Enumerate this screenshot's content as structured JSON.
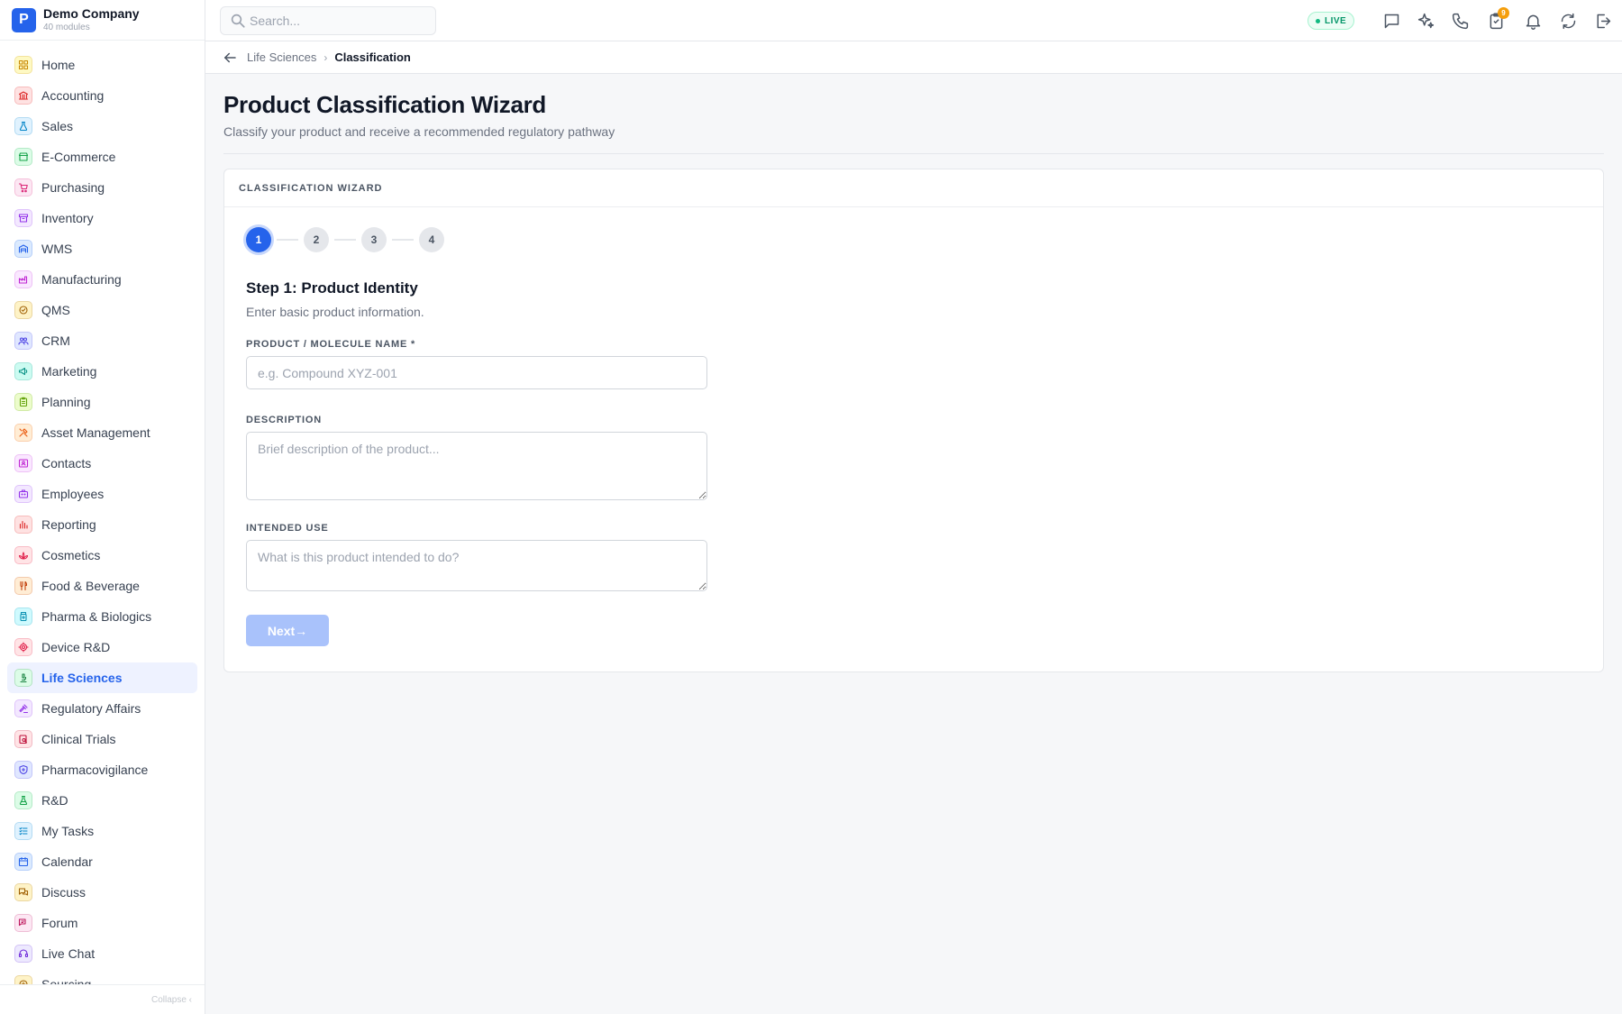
{
  "brand": {
    "logo_letter": "P",
    "name": "Demo Company",
    "subtitle": "40 modules"
  },
  "sidebar": {
    "items": [
      {
        "label": "Home",
        "icon": "grid-icon",
        "color": "#ca8a04",
        "bg": "#fef9c3",
        "active": false
      },
      {
        "label": "Accounting",
        "icon": "bank-icon",
        "color": "#dc2626",
        "bg": "#fee2e2",
        "active": false
      },
      {
        "label": "Sales",
        "icon": "flask-icon",
        "color": "#0284c7",
        "bg": "#e0f2fe",
        "active": false
      },
      {
        "label": "E-Commerce",
        "icon": "store-icon",
        "color": "#16a34a",
        "bg": "#dcfce7",
        "active": false
      },
      {
        "label": "Purchasing",
        "icon": "cart-icon",
        "color": "#db2777",
        "bg": "#fce7f3",
        "active": false
      },
      {
        "label": "Inventory",
        "icon": "archive-icon",
        "color": "#9333ea",
        "bg": "#f3e8ff",
        "active": false
      },
      {
        "label": "WMS",
        "icon": "warehouse-icon",
        "color": "#2563eb",
        "bg": "#dbeafe",
        "active": false
      },
      {
        "label": "Manufacturing",
        "icon": "factory-icon",
        "color": "#c026d3",
        "bg": "#fae8ff",
        "active": false
      },
      {
        "label": "QMS",
        "icon": "check-badge-icon",
        "color": "#a16207",
        "bg": "#fef3c7",
        "active": false
      },
      {
        "label": "CRM",
        "icon": "users-icon",
        "color": "#4f46e5",
        "bg": "#e0e7ff",
        "active": false
      },
      {
        "label": "Marketing",
        "icon": "megaphone-icon",
        "color": "#0d9488",
        "bg": "#ccfbf1",
        "active": false
      },
      {
        "label": "Planning",
        "icon": "clipboard-icon",
        "color": "#65a30d",
        "bg": "#ecfccb",
        "active": false
      },
      {
        "label": "Asset Management",
        "icon": "tools-icon",
        "color": "#ea580c",
        "bg": "#ffedd5",
        "active": false
      },
      {
        "label": "Contacts",
        "icon": "contact-card-icon",
        "color": "#c026d3",
        "bg": "#fae8ff",
        "active": false
      },
      {
        "label": "Employees",
        "icon": "briefcase-icon",
        "color": "#9333ea",
        "bg": "#f3e8ff",
        "active": false
      },
      {
        "label": "Reporting",
        "icon": "bar-chart-icon",
        "color": "#dc2626",
        "bg": "#fee2e2",
        "active": false
      },
      {
        "label": "Cosmetics",
        "icon": "lotus-icon",
        "color": "#e11d48",
        "bg": "#ffe4e6",
        "active": false
      },
      {
        "label": "Food & Beverage",
        "icon": "utensils-icon",
        "color": "#c2410c",
        "bg": "#ffedd5",
        "active": false
      },
      {
        "label": "Pharma & Biologics",
        "icon": "pill-bottle-icon",
        "color": "#0891b2",
        "bg": "#cffafe",
        "active": false
      },
      {
        "label": "Device R&D",
        "icon": "gear-chip-icon",
        "color": "#e11d48",
        "bg": "#ffe4e6",
        "active": false
      },
      {
        "label": "Life Sciences",
        "icon": "microscope-icon",
        "color": "#15803d",
        "bg": "#dcfce7",
        "active": true
      },
      {
        "label": "Regulatory Affairs",
        "icon": "gavel-icon",
        "color": "#9333ea",
        "bg": "#f3e8ff",
        "active": false
      },
      {
        "label": "Clinical Trials",
        "icon": "clipboard-search-icon",
        "color": "#be123c",
        "bg": "#ffe4e6",
        "active": false
      },
      {
        "label": "Pharmacovigilance",
        "icon": "shield-icon",
        "color": "#4f46e5",
        "bg": "#e0e7ff",
        "active": false
      },
      {
        "label": "R&D",
        "icon": "beaker-icon",
        "color": "#16a34a",
        "bg": "#dcfce7",
        "active": false
      },
      {
        "label": "My Tasks",
        "icon": "list-check-icon",
        "color": "#0284c7",
        "bg": "#e0f2fe",
        "active": false
      },
      {
        "label": "Calendar",
        "icon": "calendar-icon",
        "color": "#2563eb",
        "bg": "#dbeafe",
        "active": false
      },
      {
        "label": "Discuss",
        "icon": "chat-bubbles-icon",
        "color": "#a16207",
        "bg": "#fef3c7",
        "active": false
      },
      {
        "label": "Forum",
        "icon": "forum-icon",
        "color": "#be185d",
        "bg": "#fce7f3",
        "active": false
      },
      {
        "label": "Live Chat",
        "icon": "headset-icon",
        "color": "#6d28d9",
        "bg": "#ede9fe",
        "active": false
      },
      {
        "label": "Sourcing",
        "icon": "sourcing-icon",
        "color": "#a16207",
        "bg": "#fef3c7",
        "active": false
      }
    ],
    "collapse_label": "Collapse ‹"
  },
  "topbar": {
    "search_placeholder": "Search...",
    "live_label": "LIVE",
    "notification_badge": "9",
    "icons": [
      "message-icon",
      "sparkles-icon",
      "phone-icon",
      "clipboard-badge-icon",
      "bell-icon",
      "refresh-icon",
      "logout-icon"
    ]
  },
  "breadcrumb": {
    "parent": "Life Sciences",
    "separator": "›",
    "current": "Classification"
  },
  "page": {
    "title": "Product Classification Wizard",
    "subtitle": "Classify your product and receive a recommended regulatory pathway"
  },
  "wizard": {
    "header": "CLASSIFICATION WIZARD",
    "steps": [
      "1",
      "2",
      "3",
      "4"
    ],
    "active_step": 1,
    "step_title": "Step 1: Product Identity",
    "step_subtitle": "Enter basic product information.",
    "fields": {
      "name_label": "PRODUCT / MOLECULE NAME *",
      "name_value": "",
      "name_placeholder": "e.g. Compound XYZ-001",
      "description_label": "DESCRIPTION",
      "description_value": "",
      "description_placeholder": "Brief description of the product...",
      "intended_use_label": "INTENDED USE",
      "intended_use_value": "",
      "intended_use_placeholder": "What is this product intended to do?"
    },
    "next_label": "Next→"
  },
  "colors": {
    "accent": "#2563eb",
    "live": "#059669",
    "badge": "#f59e0b"
  }
}
